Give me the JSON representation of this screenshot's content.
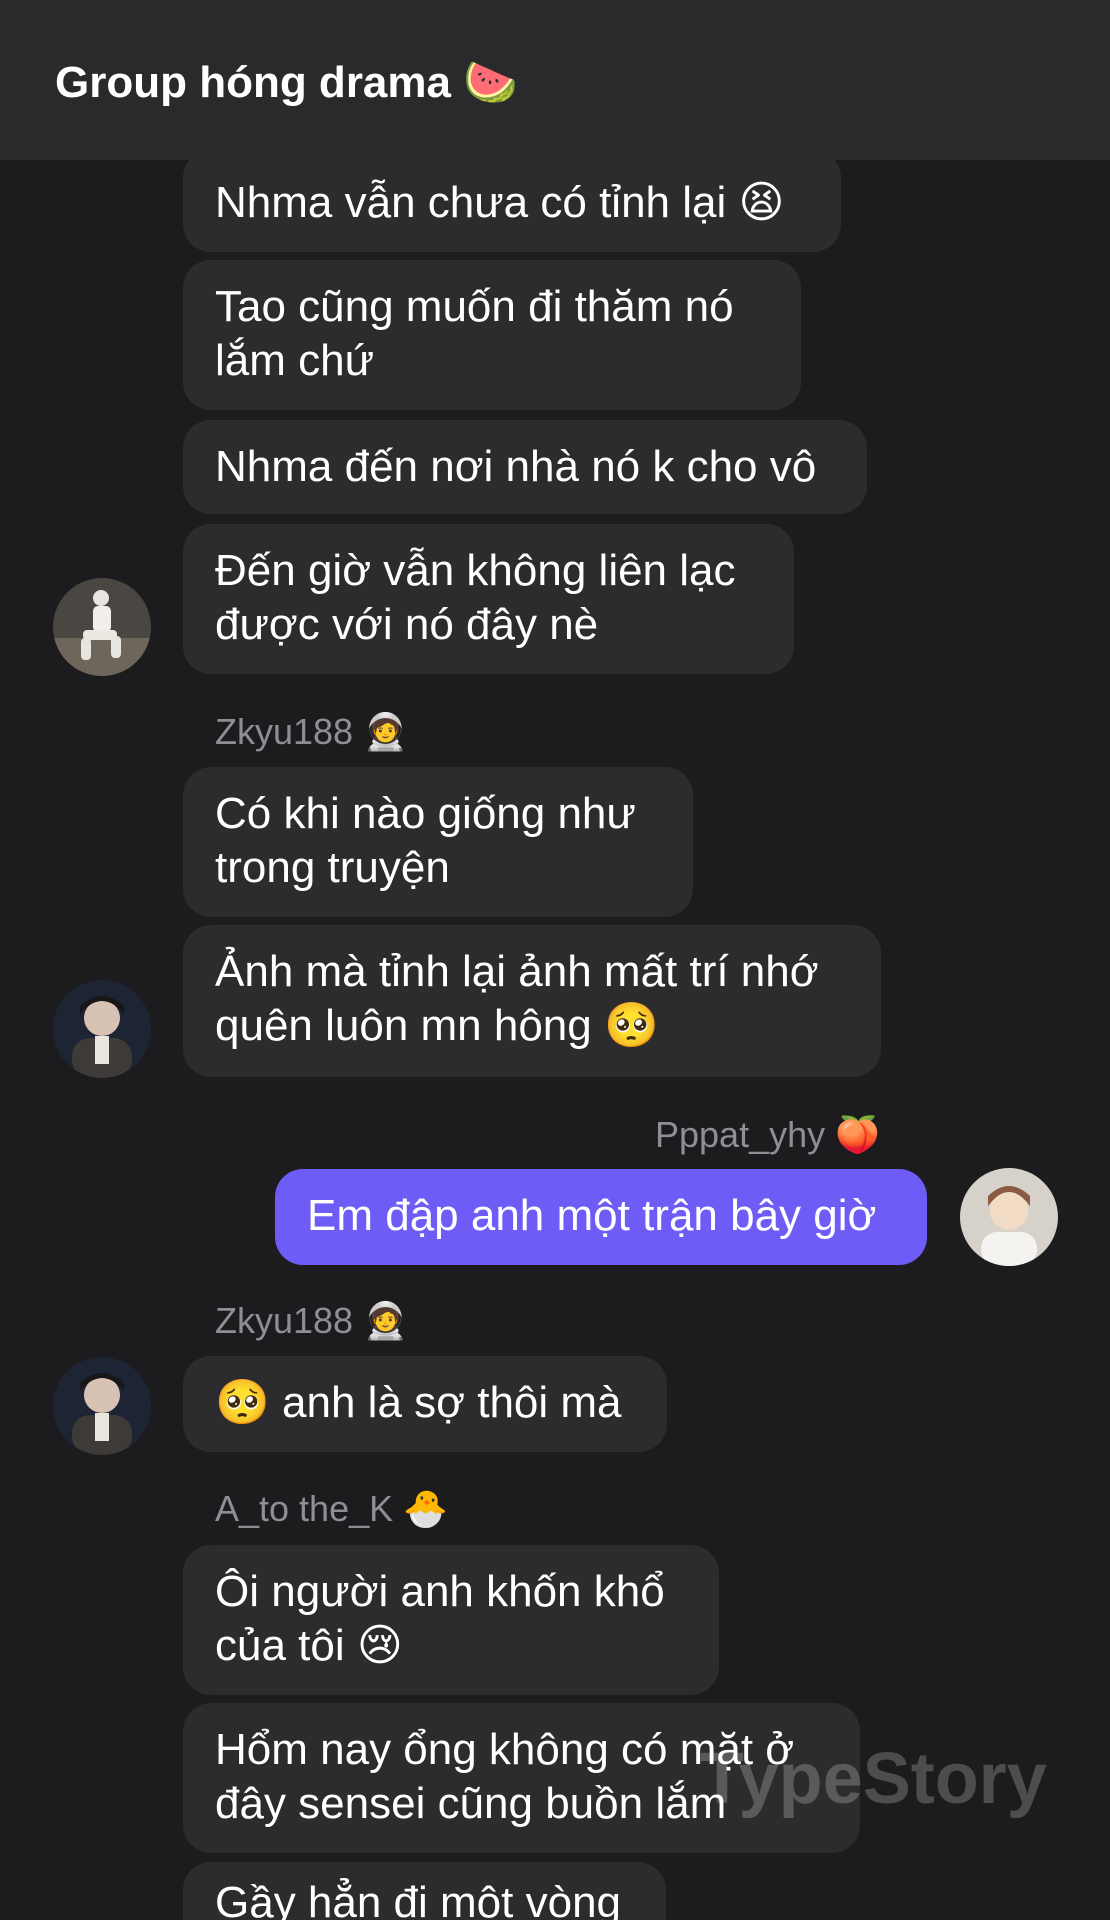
{
  "header": {
    "title": "Group hóng drama",
    "title_emoji": "🍉"
  },
  "messages": [
    {
      "text": "Nhma vẫn chưa có tỉnh lại",
      "emoji": "😫"
    },
    {
      "line1": "Tao cũng muốn đi thăm nó",
      "line2": "lắm chứ"
    },
    {
      "text": "Nhma đến nơi nhà nó k cho vô"
    },
    {
      "line1": "Đến giờ vẫn không liên lạc",
      "line2": "được với nó đây nè"
    },
    {
      "sender": "Zkyu188",
      "sender_emoji": "🧑‍🚀"
    },
    {
      "line1": "Có khi nào giống như",
      "line2": "trong truyện"
    },
    {
      "line1": "Ảnh mà tỉnh lại ảnh mất trí nhớ",
      "line2": "quên luôn mn hông",
      "emoji": "🥺"
    },
    {
      "sender": "Pppat_yhy",
      "sender_emoji": "🍑"
    },
    {
      "text": "Em đập anh một trận bây giờ"
    },
    {
      "sender": "Zkyu188",
      "sender_emoji": "🧑‍🚀"
    },
    {
      "emoji": "🥺",
      "text": "anh là sợ thôi mà"
    },
    {
      "sender": "A_to the_K",
      "sender_emoji": "🐣"
    },
    {
      "line1": "Ôi người anh khốn khổ",
      "line2": "của tôi",
      "emoji": "😢"
    },
    {
      "line1": "Hổm nay ổng không có mặt ở",
      "line2": "đây sensei cũng buồn lắm"
    },
    {
      "text": "Gầy hẳn đi một vòng"
    }
  ],
  "watermark": "TypeStory",
  "colors": {
    "background": "#1c1c1e",
    "header": "#2a2a2c",
    "incoming_bubble": "#2c2c2e",
    "outgoing_bubble": "#6e5cf6",
    "sender_name": "#8e8e93"
  }
}
